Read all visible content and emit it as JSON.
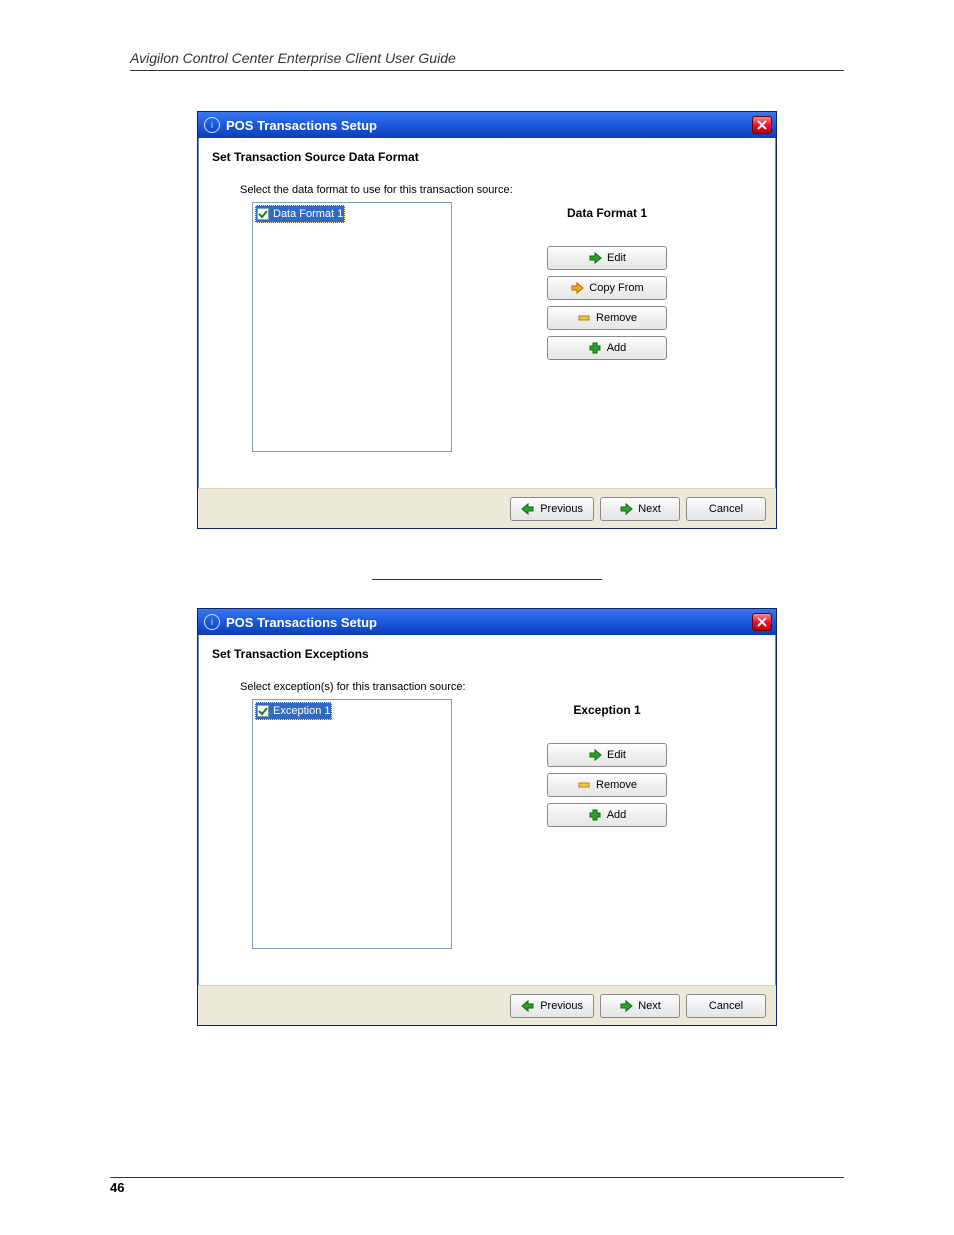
{
  "doc": {
    "header": "Avigilon Control Center Enterprise Client User Guide",
    "page_number": "46"
  },
  "dialog1": {
    "title": "POS Transactions Setup",
    "subtitle": "Set Transaction Source Data Format",
    "instruction": "Select the data format to use for this transaction source:",
    "list_item": "Data Format 1",
    "selected_title": "Data Format 1",
    "buttons": {
      "edit": "Edit",
      "copy_from": "Copy From",
      "remove": "Remove",
      "add": "Add"
    },
    "footer": {
      "previous": "Previous",
      "next": "Next",
      "cancel": "Cancel"
    }
  },
  "dialog2": {
    "title": "POS Transactions Setup",
    "subtitle": "Set Transaction Exceptions",
    "instruction": "Select exception(s) for this transaction source:",
    "list_item": "Exception 1",
    "selected_title": "Exception 1",
    "buttons": {
      "edit": "Edit",
      "remove": "Remove",
      "add": "Add"
    },
    "footer": {
      "previous": "Previous",
      "next": "Next",
      "cancel": "Cancel"
    }
  }
}
